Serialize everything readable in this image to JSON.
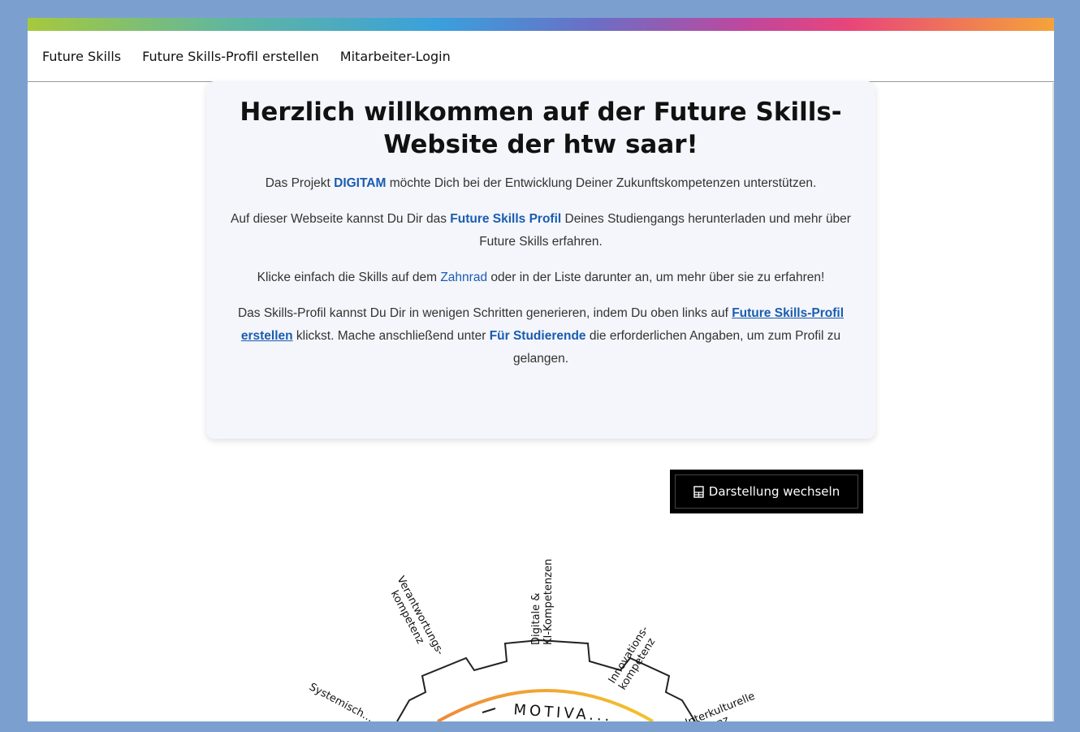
{
  "nav": {
    "items": [
      "Future Skills",
      "Future Skills-Profil erstellen",
      "Mitarbeiter-Login"
    ]
  },
  "welcome": {
    "title": "Herzlich willkommen auf der Future Skills-Website der htw saar!",
    "p1_a": "Das Projekt ",
    "p1_link": "DIGITAM",
    "p1_b": " möchte Dich bei der Entwicklung Deiner Zukunftskompetenzen unterstützen.",
    "p2_a": "Auf dieser Webseite kannst Du Dir das ",
    "p2_link": "Future Skills Profil",
    "p2_b": " Deines Studiengangs herunterladen und mehr über Future Skills erfahren.",
    "p3_a": "Klicke einfach die Skills auf dem ",
    "p3_link": "Zahnrad",
    "p3_b": " oder in der Liste darunter an, um mehr über sie zu erfahren!",
    "p4_a": "Das Skills-Profil kannst Du Dir in wenigen Schritten generieren, indem Du oben links auf ",
    "p4_link": "Future Skills-Profil erstellen",
    "p4_b": " klickst. Mache anschließend unter ",
    "p4_link2": "Für Studierende",
    "p4_c": " die erforderlichen Angaben, um zum Profil zu gelangen."
  },
  "toggle_button": {
    "label": "Darstellung wechseln",
    "icon": "table-icon"
  },
  "wheel": {
    "labels": {
      "digital": [
        "Digitale &",
        "KI-Kompetenzen"
      ],
      "verantwortung": [
        "Verantwortungs-",
        "kompetenz"
      ],
      "innovation": [
        "Innovations-",
        "kompetenz"
      ],
      "systemisch": "Systemisch...",
      "interkulturell": [
        "Interkulturelle",
        "...tenz"
      ],
      "center": "MOTIVA..."
    }
  },
  "colors": {
    "link": "#1a5cb0",
    "background": "#7ba0d0",
    "card": "#f4f6fb"
  }
}
